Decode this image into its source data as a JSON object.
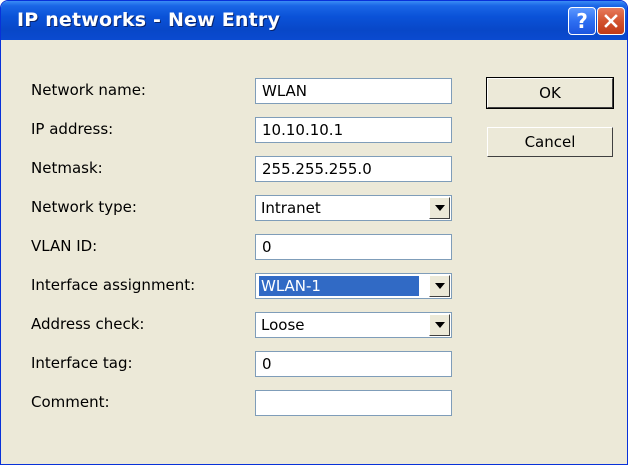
{
  "window": {
    "title": "IP networks - New Entry",
    "help_icon": "?",
    "close_icon": "close-x",
    "title_bar_color": "#0a52d8"
  },
  "form": {
    "network_name": {
      "label": "Network name:",
      "value": "WLAN"
    },
    "ip_address": {
      "label": "IP address:",
      "value": "10.10.10.1"
    },
    "netmask": {
      "label": "Netmask:",
      "value": "255.255.255.0"
    },
    "network_type": {
      "label": "Network type:",
      "value": "Intranet"
    },
    "vlan_id": {
      "label": "VLAN ID:",
      "value": "0"
    },
    "interface_assignment": {
      "label": "Interface assignment:",
      "value": "WLAN-1"
    },
    "address_check": {
      "label": "Address check:",
      "value": "Loose"
    },
    "interface_tag": {
      "label": "Interface tag:",
      "value": "0"
    },
    "comment": {
      "label": "Comment:",
      "value": ""
    }
  },
  "buttons": {
    "ok": "OK",
    "cancel": "Cancel"
  }
}
